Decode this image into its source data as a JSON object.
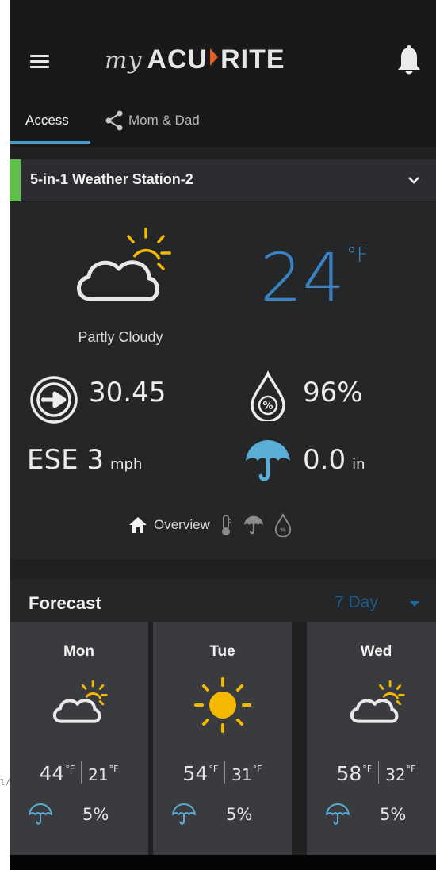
{
  "edge_text": "l/",
  "header": {
    "logo_my": "my",
    "logo_acu": "ACU",
    "logo_rite": "RITE",
    "tabs": [
      {
        "label": "Access"
      },
      {
        "label": "Mom & Dad"
      }
    ]
  },
  "device": {
    "name": "5-in-1 Weather Station-2"
  },
  "current": {
    "condition": "Partly Cloudy",
    "temperature": "24",
    "temperature_unit": "°F",
    "pressure": "30.45",
    "humidity": "96%",
    "wind_direction_speed": "ESE 3",
    "wind_unit": "mph",
    "rain": "0.0",
    "rain_unit": "in",
    "subnav_overview": "Overview"
  },
  "forecast": {
    "title": "Forecast",
    "range": "7 Day",
    "days": [
      {
        "name": "Mon",
        "high": "44",
        "low": "21",
        "unit": "°F",
        "precip": "5%",
        "icon": "partly-cloudy"
      },
      {
        "name": "Tue",
        "high": "54",
        "low": "31",
        "unit": "°F",
        "precip": "5%",
        "icon": "sunny"
      },
      {
        "name": "Wed",
        "high": "58",
        "low": "32",
        "unit": "°F",
        "precip": "5%",
        "icon": "partly-cloudy"
      }
    ]
  },
  "colors": {
    "background": "#1f2022",
    "accent_blue": "#3a82c4",
    "device_accent": "#5fbf49",
    "sun": "#f5b800",
    "umbrella": "#5aaed6"
  }
}
